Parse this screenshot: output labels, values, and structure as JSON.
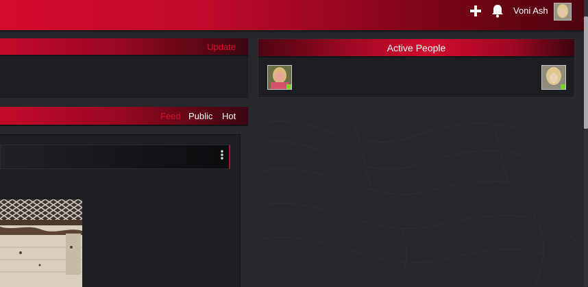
{
  "topbar": {
    "icons": [
      "plus-icon",
      "bell-icon"
    ],
    "user_name": "Voni Ash",
    "colors": {
      "accent": "#d30a2c",
      "dark_accent": "#4d0310"
    }
  },
  "panel_top": {
    "action_label": "Update"
  },
  "active_people": {
    "title": "Active People",
    "status_color": "#7bd12b"
  },
  "feed": {
    "tabs": [
      {
        "label": "Feed",
        "active": true
      },
      {
        "label": "Public",
        "active": false
      },
      {
        "label": "Hot",
        "active": false
      }
    ],
    "menu_icon": "kebab-menu-icon"
  }
}
